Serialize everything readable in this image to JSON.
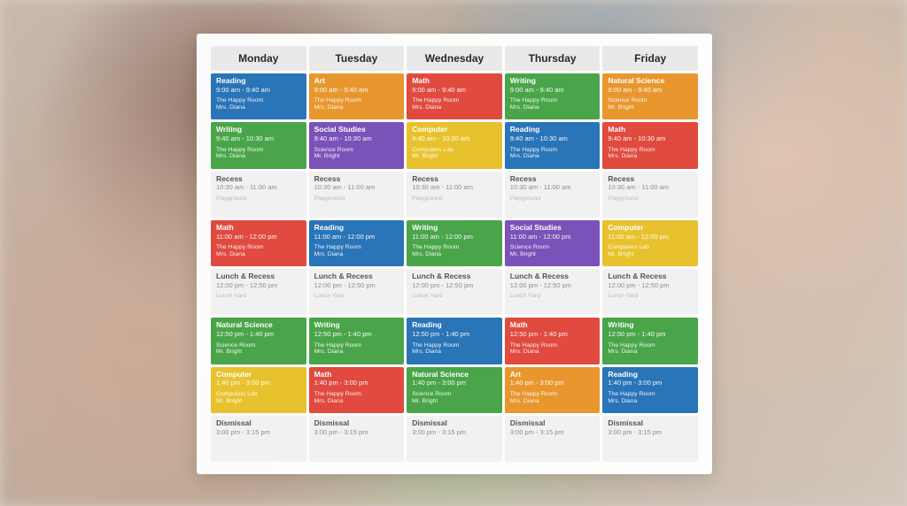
{
  "days": [
    "Monday",
    "Tuesday",
    "Wednesday",
    "Thursday",
    "Friday"
  ],
  "colors": {
    "Reading": "c-blue",
    "Art": "c-orange",
    "Math": "c-red",
    "Writing": "c-green",
    "Natural Science": "c-green",
    "Social Studies": "c-purple",
    "Computer": "c-yellow",
    "Recess": "c-grey",
    "Lunch & Recess": "c-grey",
    "Dismissal": "c-grey"
  },
  "schedule": [
    [
      {
        "subject": "Reading",
        "time": "9:00 am - 9:40 am",
        "room": "The Happy Room",
        "teacher": "Mrs. Diana"
      },
      {
        "subject": "Art",
        "time": "9:00 am - 9:40 am",
        "room": "The Happy Room",
        "teacher": "Mrs. Diana"
      },
      {
        "subject": "Math",
        "time": "9:00 am - 9:40 am",
        "room": "The Happy Room",
        "teacher": "Mrs. Diana"
      },
      {
        "subject": "Writing",
        "time": "9:00 am - 9:40 am",
        "room": "The Happy Room",
        "teacher": "Mrs. Diana"
      },
      {
        "subject": "Natural Science",
        "time": "9:00 am - 9:40 am",
        "room": "Science Room",
        "teacher": "Mr. Bright"
      }
    ],
    [
      {
        "subject": "Writing",
        "time": "9:40 am - 10:30 am",
        "room": "The Happy Room",
        "teacher": "Mrs. Diana"
      },
      {
        "subject": "Social Studies",
        "time": "9:40 am - 10:30 am",
        "room": "Science Room",
        "teacher": "Mr. Bright"
      },
      {
        "subject": "Computer",
        "time": "9:40 am - 10:30 am",
        "room": "Computers Lab",
        "teacher": "Mr. Bright"
      },
      {
        "subject": "Reading",
        "time": "9:40 am - 10:30 am",
        "room": "The Happy Room",
        "teacher": "Mrs. Diana"
      },
      {
        "subject": "Math",
        "time": "9:40 am - 10:30 am",
        "room": "The Happy Room",
        "teacher": "Mrs. Diana"
      }
    ],
    [
      {
        "subject": "Recess",
        "time": "10:30 am - 11:00 am",
        "room": "Playground",
        "teacher": ""
      },
      {
        "subject": "Recess",
        "time": "10:30 am - 11:00 am",
        "room": "Playground",
        "teacher": ""
      },
      {
        "subject": "Recess",
        "time": "10:30 am - 11:00 am",
        "room": "Playground",
        "teacher": ""
      },
      {
        "subject": "Recess",
        "time": "10:30 am - 11:00 am",
        "room": "Playground",
        "teacher": ""
      },
      {
        "subject": "Recess",
        "time": "10:30 am - 11:00 am",
        "room": "Playground",
        "teacher": ""
      }
    ],
    [
      {
        "subject": "Math",
        "time": "11:00 am - 12:00 pm",
        "room": "The Happy Room",
        "teacher": "Mrs. Diana"
      },
      {
        "subject": "Reading",
        "time": "11:00 am - 12:00 pm",
        "room": "The Happy Room",
        "teacher": "Mrs. Diana"
      },
      {
        "subject": "Writing",
        "time": "11:00 am - 12:00 pm",
        "room": "The Happy Room",
        "teacher": "Mrs. Diana"
      },
      {
        "subject": "Social Studies",
        "time": "11:00 am - 12:00 pm",
        "room": "Science Room",
        "teacher": "Mr. Bright"
      },
      {
        "subject": "Computer",
        "time": "11:00 am - 12:00 pm",
        "room": "Computers Lab",
        "teacher": "Mr. Bright"
      }
    ],
    [
      {
        "subject": "Lunch & Recess",
        "time": "12:00 pm - 12:50 pm",
        "room": "Lunch Yard",
        "teacher": ""
      },
      {
        "subject": "Lunch & Recess",
        "time": "12:00 pm - 12:50 pm",
        "room": "Lunch Yard",
        "teacher": ""
      },
      {
        "subject": "Lunch & Recess",
        "time": "12:00 pm - 12:50 pm",
        "room": "Lunch Yard",
        "teacher": ""
      },
      {
        "subject": "Lunch & Recess",
        "time": "12:00 pm - 12:50 pm",
        "room": "Lunch Yard",
        "teacher": ""
      },
      {
        "subject": "Lunch & Recess",
        "time": "12:00 pm - 12:50 pm",
        "room": "Lunch Yard",
        "teacher": ""
      }
    ],
    [
      {
        "subject": "Natural Science",
        "time": "12:50 pm - 1:40 pm",
        "room": "Science Room",
        "teacher": "Mr. Bright"
      },
      {
        "subject": "Writing",
        "time": "12:50 pm - 1:40 pm",
        "room": "The Happy Room",
        "teacher": "Mrs. Diana"
      },
      {
        "subject": "Reading",
        "time": "12:50 pm - 1:40 pm",
        "room": "The Happy Room",
        "teacher": "Mrs. Diana"
      },
      {
        "subject": "Math",
        "time": "12:50 pm - 1:40 pm",
        "room": "The Happy Room",
        "teacher": "Mrs. Diana"
      },
      {
        "subject": "Writing",
        "time": "12:50 pm - 1:40 pm",
        "room": "The Happy Room",
        "teacher": "Mrs. Diana"
      }
    ],
    [
      {
        "subject": "Computer",
        "time": "1:40 pm - 3:00 pm",
        "room": "Computers Lab",
        "teacher": "Mr. Bright"
      },
      {
        "subject": "Math",
        "time": "1:40 pm - 3:00 pm",
        "room": "The Happy Room",
        "teacher": "Mrs. Diana"
      },
      {
        "subject": "Natural Science",
        "time": "1:40 pm - 3:00 pm",
        "room": "Science Room",
        "teacher": "Mr. Bright"
      },
      {
        "subject": "Art",
        "time": "1:40 pm - 3:00 pm",
        "room": "The Happy Room",
        "teacher": "Mrs. Diana"
      },
      {
        "subject": "Reading",
        "time": "1:40 pm - 3:00 pm",
        "room": "The Happy Room",
        "teacher": "Mrs. Diana"
      }
    ],
    [
      {
        "subject": "Dismissal",
        "time": "3:00 pm - 3:15 pm",
        "room": "",
        "teacher": ""
      },
      {
        "subject": "Dismissal",
        "time": "3:00 pm - 3:15 pm",
        "room": "",
        "teacher": ""
      },
      {
        "subject": "Dismissal",
        "time": "3:00 pm - 3:15 pm",
        "room": "",
        "teacher": ""
      },
      {
        "subject": "Dismissal",
        "time": "3:00 pm - 3:15 pm",
        "room": "",
        "teacher": ""
      },
      {
        "subject": "Dismissal",
        "time": "3:00 pm - 3:15 pm",
        "room": "",
        "teacher": ""
      }
    ]
  ],
  "overrides": {
    "0-4": "c-orange",
    "6-0": "c-yellow"
  }
}
